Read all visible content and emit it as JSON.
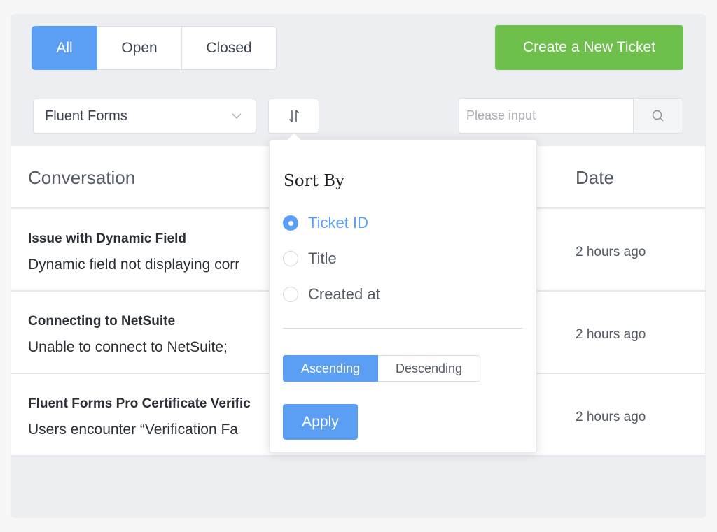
{
  "filter_tabs": [
    {
      "label": "All",
      "active": true
    },
    {
      "label": "Open",
      "active": false
    },
    {
      "label": "Closed",
      "active": false
    }
  ],
  "create_button": {
    "label": "Create a New Ticket"
  },
  "form_select": {
    "value": "Fluent Forms",
    "icon": "chevron-down-icon"
  },
  "sort_toggle": {
    "icon": "sort-arrows-icon"
  },
  "search": {
    "placeholder": "Please input",
    "icon": "search-icon"
  },
  "table": {
    "headers": {
      "conversation": "Conversation",
      "date": "Date"
    },
    "rows": [
      {
        "title": "Issue with Dynamic Field",
        "description": "Dynamic field not displaying corr",
        "date": "2 hours ago"
      },
      {
        "title": "Connecting to NetSuite",
        "description": "Unable to connect to NetSuite;",
        "date": "2 hours ago"
      },
      {
        "title": "Fluent Forms Pro Certificate Verific",
        "description": "Users encounter “Verification Fa",
        "date": "2 hours ago"
      }
    ]
  },
  "sort_popover": {
    "title": "Sort By",
    "options": [
      {
        "label": "Ticket ID",
        "checked": true
      },
      {
        "label": "Title",
        "checked": false
      },
      {
        "label": "Created at",
        "checked": false
      }
    ],
    "order": {
      "ascending": "Ascending",
      "descending": "Descending",
      "selected": "Ascending"
    },
    "apply_label": "Apply"
  },
  "colors": {
    "primary": "#5b9ff5",
    "success": "#6fbf4c",
    "background": "#eceef1"
  }
}
